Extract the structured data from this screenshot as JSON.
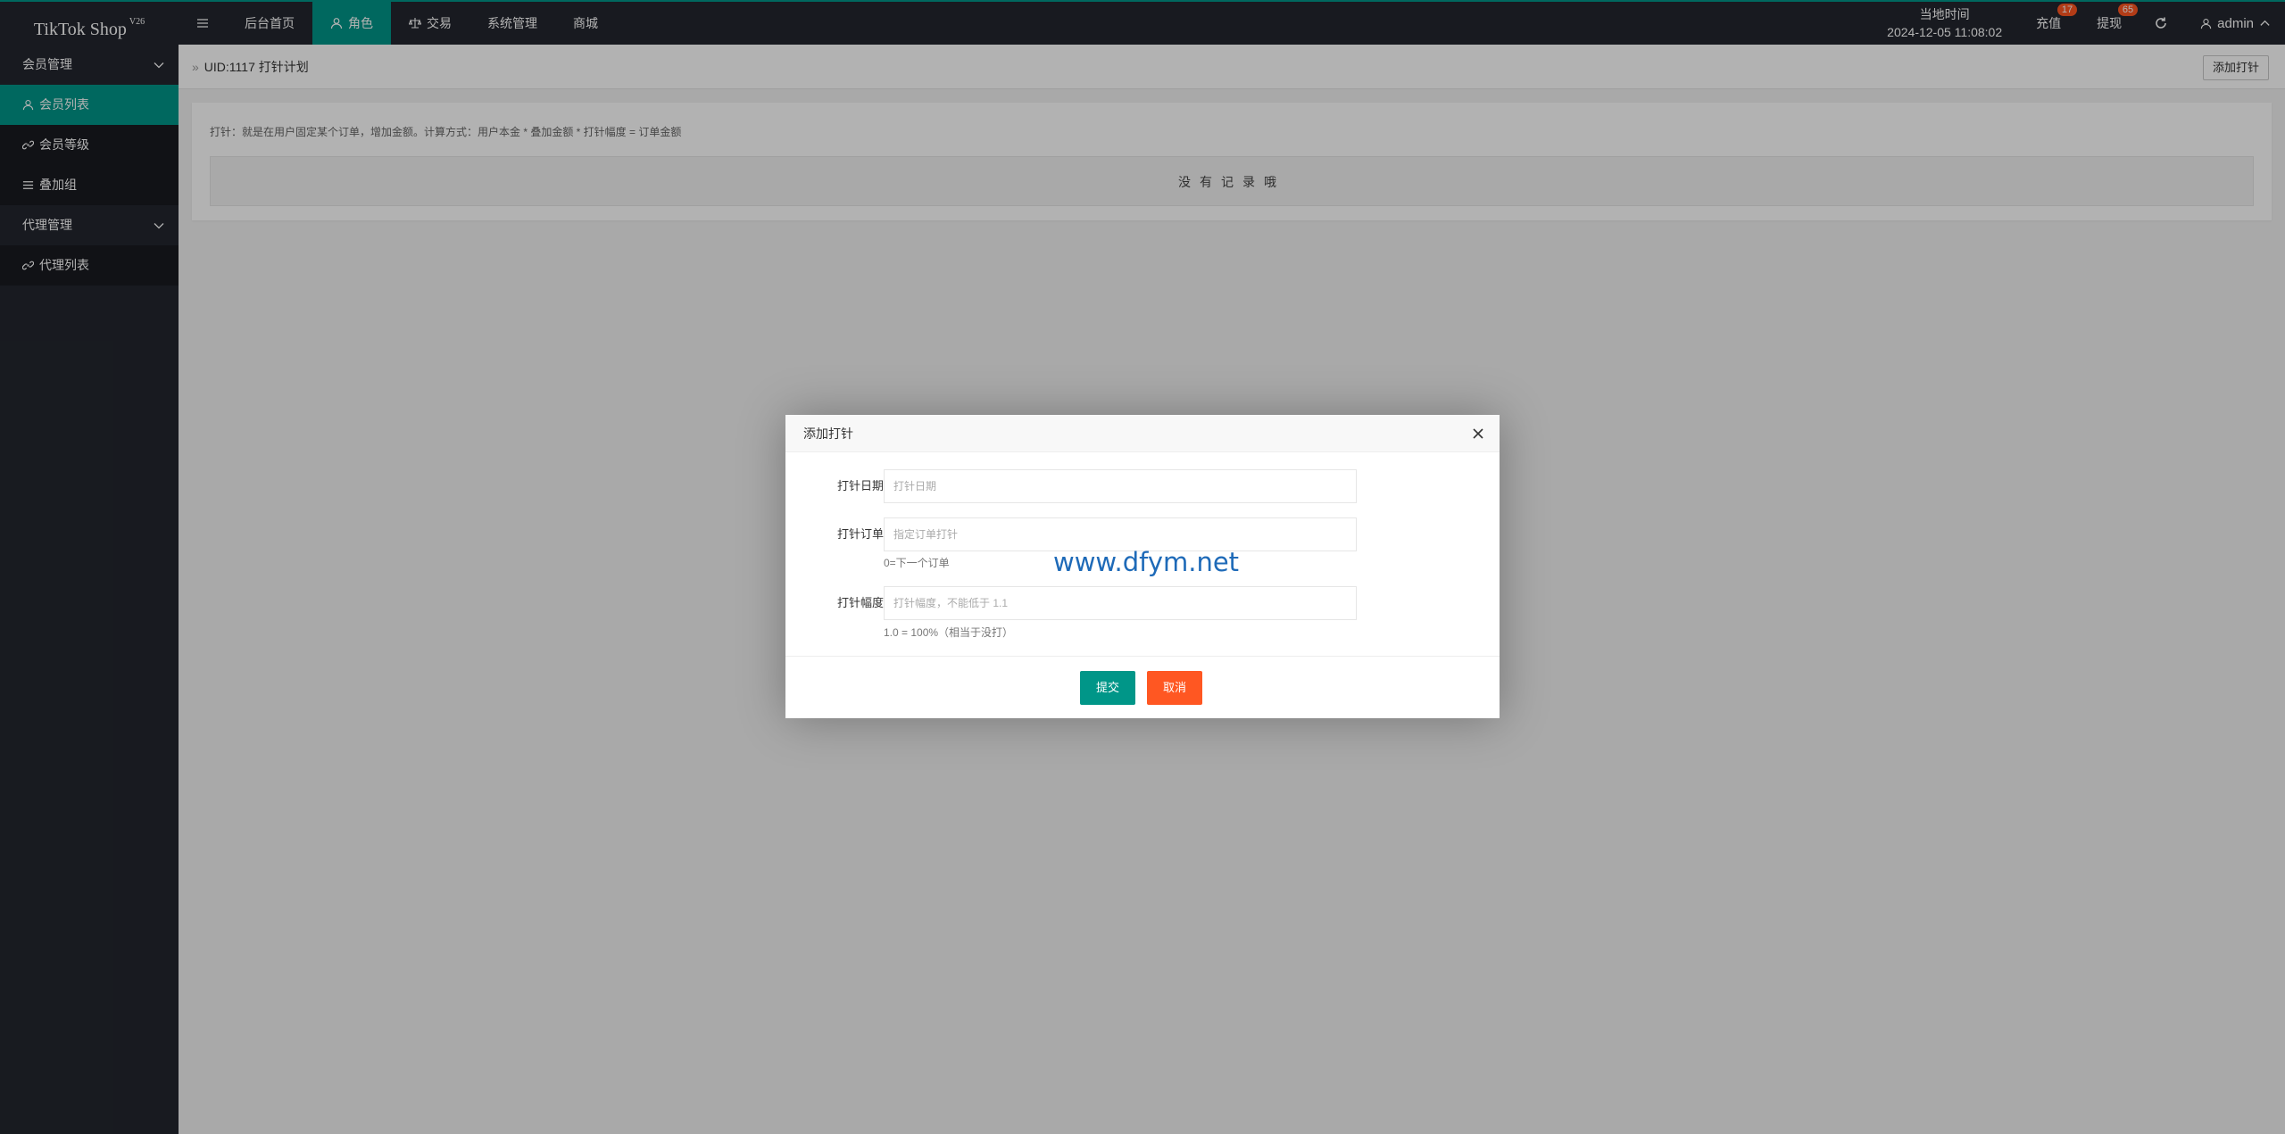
{
  "app": {
    "logo": "TikTok Shop",
    "version": "V26"
  },
  "topnav": {
    "items": [
      {
        "label": "后台首页",
        "icon": ""
      },
      {
        "label": "角色",
        "icon": "user-icon",
        "active": true
      },
      {
        "label": "交易",
        "icon": "scale-icon"
      },
      {
        "label": "系统管理",
        "icon": ""
      },
      {
        "label": "商城",
        "icon": ""
      }
    ],
    "clock_label": "当地时间",
    "clock_value": "2024-12-05 11:08:02",
    "recharge_label": "充值",
    "recharge_badge": "17",
    "withdraw_label": "提现",
    "withdraw_badge": "65",
    "user_label": "admin"
  },
  "sidebar": {
    "groups": [
      {
        "label": "会员管理",
        "items": [
          {
            "label": "会员列表",
            "icon": "user-icon",
            "active": true
          },
          {
            "label": "会员等级",
            "icon": "link-icon"
          },
          {
            "label": "叠加组",
            "icon": "list-icon"
          }
        ]
      },
      {
        "label": "代理管理",
        "items": [
          {
            "label": "代理列表",
            "icon": "link-icon"
          }
        ]
      }
    ]
  },
  "page": {
    "breadcrumb": "UID:1117 打针计划",
    "add_button": "添加打针",
    "note": "打针：就是在用户固定某个订单，增加金额。计算方式：用户本金 * 叠加金额 * 打针幅度 = 订单金额",
    "empty_text": "没有记录哦"
  },
  "modal": {
    "title": "添加打针",
    "fields": [
      {
        "label": "打针日期",
        "placeholder": "打针日期",
        "value": ""
      },
      {
        "label": "打针订单",
        "placeholder": "指定订单打针",
        "value": "",
        "hint": "0=下一个订单"
      },
      {
        "label": "打针幅度",
        "placeholder": "打针幅度，不能低于 1.1",
        "value": "",
        "hint": "1.0 = 100%（相当于没打）"
      }
    ],
    "watermark": "www.dfym.net",
    "submit_label": "提交",
    "cancel_label": "取消"
  },
  "colors": {
    "accent": "#009688",
    "danger": "#ff5722",
    "dark": "#23262e"
  }
}
